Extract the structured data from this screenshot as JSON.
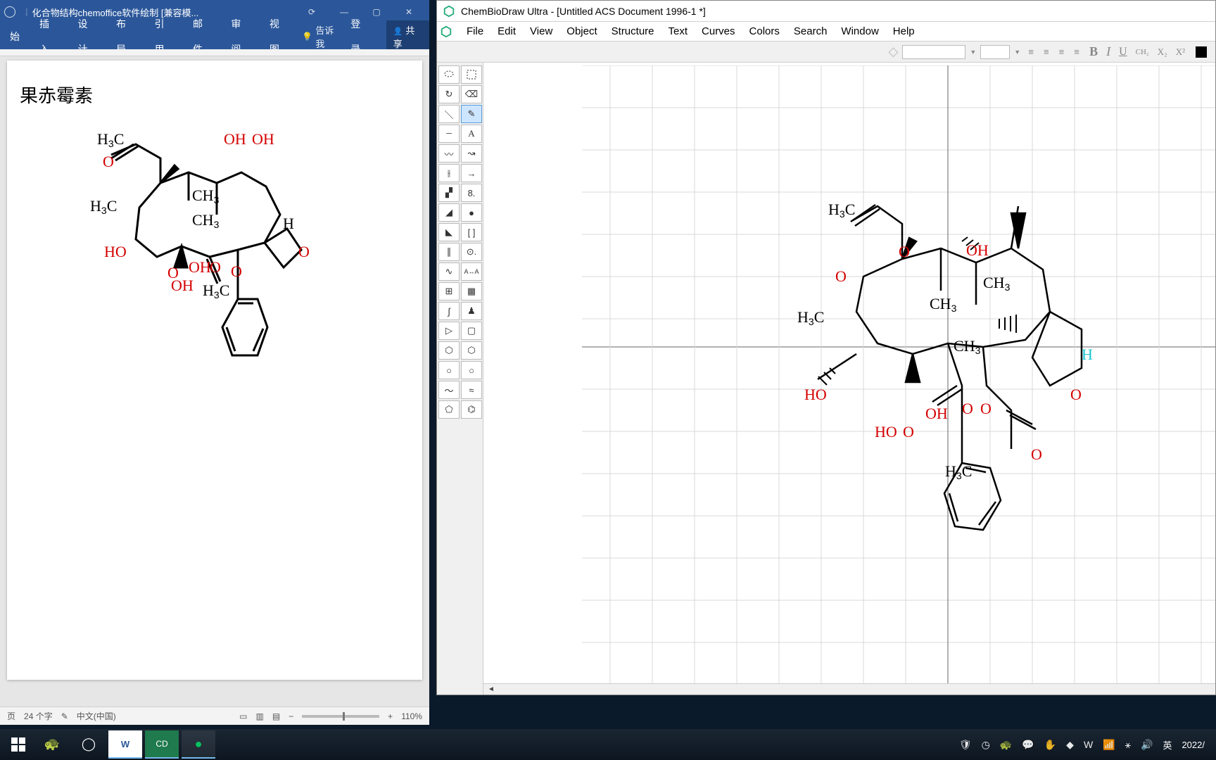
{
  "word": {
    "title": "化合物结构chemoffice软件绘制 [兼容模...",
    "tabs": [
      "始",
      "插入",
      "设计",
      "布局",
      "引用",
      "邮件",
      "审阅",
      "视图"
    ],
    "tell": "告诉我",
    "login": "登录",
    "share": "共享",
    "heading": "果赤霉素",
    "status": {
      "page": "页",
      "words": "24 个字",
      "lang": "中文(中国)",
      "zoom": "110%"
    }
  },
  "cd": {
    "title": "ChemBioDraw Ultra - [Untitled ACS Document 1996-1 *]",
    "menus": [
      "File",
      "Edit",
      "View",
      "Object",
      "Structure",
      "Text",
      "Curves",
      "Colors",
      "Search",
      "Window",
      "Help"
    ],
    "fmt": {
      "ch2": "CH₂",
      "x2": "X₂",
      "xsup": "X²"
    },
    "tools": [
      "lasso",
      "marquee",
      "hand",
      "erase",
      "line",
      "pen",
      "dash",
      "A",
      "wavy",
      "arrow2",
      "hash",
      "arrow",
      "hatch",
      "dot",
      "wedge",
      "sphere",
      "wedgeH",
      "bracket",
      "dbl",
      "target",
      "zig",
      "AaA",
      "table",
      "clip",
      "curve",
      "person",
      "play",
      "square",
      "hex",
      "hex2",
      "circ",
      "circ2",
      "wave1",
      "wave2",
      "pent",
      "benz"
    ],
    "selected_tool": 5,
    "atoms": {
      "H3C": "H₃C",
      "OH": "OH",
      "CH3": "CH₃",
      "O": "O",
      "HO": "HO",
      "H": "H"
    }
  },
  "taskbar": {
    "ime": "英",
    "date": "2022/"
  }
}
